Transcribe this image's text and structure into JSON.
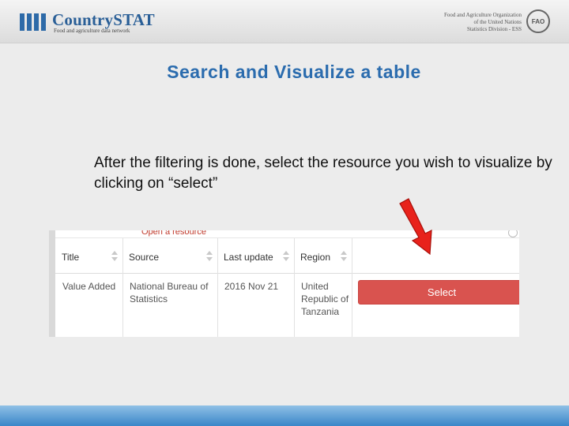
{
  "header": {
    "brand": "CountrySTAT",
    "tagline": "Food and agriculture data network",
    "org_lines": [
      "Food and Agriculture Organization",
      "of the United Nations",
      "Statistics Division - ESS"
    ],
    "emblem_text": "FAO"
  },
  "slide": {
    "title": "Search and Visualize a table",
    "instruction": "After the filtering is done, select the resource you wish to visualize by clicking on “select”"
  },
  "screenshot": {
    "header_text": "Open a resource",
    "columns": [
      "Title",
      "Source",
      "Last update",
      "Region"
    ],
    "row": {
      "title": "Value Added",
      "source": "National Bureau of Statistics",
      "last_update": "2016 Nov 21",
      "region": "United Republic of Tanzania"
    },
    "select_label": "Select"
  },
  "colors": {
    "accent_blue": "#2b6cae",
    "button_red": "#d9534f",
    "arrow_red": "#e8221b"
  },
  "icons": [
    "sort-icon",
    "close-icon",
    "arrow-icon",
    "fao-emblem-icon"
  ]
}
